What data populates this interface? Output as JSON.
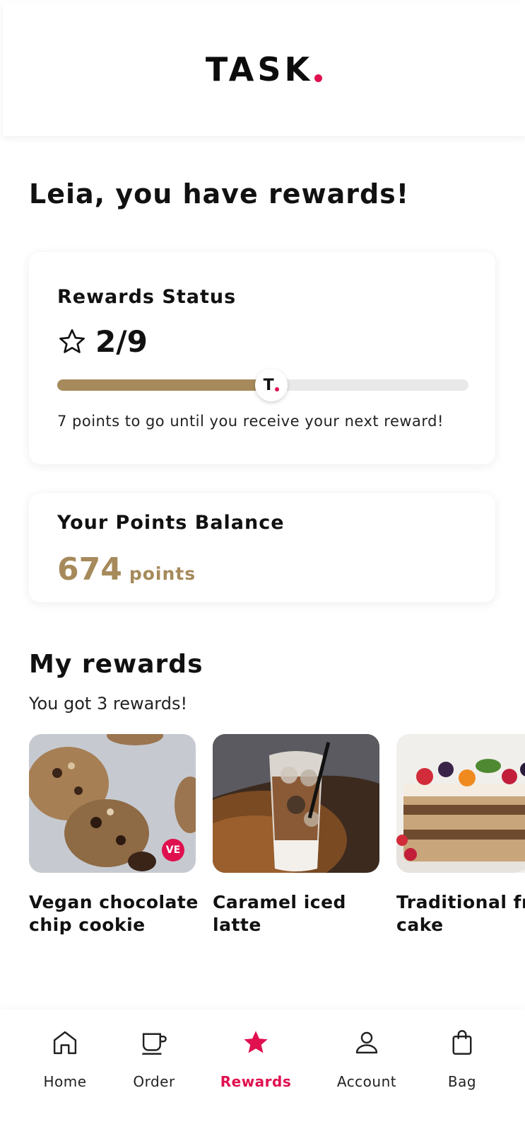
{
  "brand": {
    "name": "TASK",
    "accent": "#e0104f",
    "gold": "#a68a5b"
  },
  "greeting": "Leia, you have rewards!",
  "rewards_status": {
    "title": "Rewards Status",
    "count": "2/9",
    "progress_fraction": 0.52,
    "knob_letter": "T",
    "message": "7 points to go until you receive your next reward!"
  },
  "balance": {
    "title": "Your Points Balance",
    "value": "674",
    "unit": "points"
  },
  "my_rewards": {
    "title": "My rewards",
    "subtitle": "You got 3 rewards!",
    "items": [
      {
        "title": "Vegan chocolate chip cookie",
        "badge": "VE"
      },
      {
        "title": "Caramel iced latte"
      },
      {
        "title": "Traditional fruit cake"
      }
    ]
  },
  "nav": {
    "items": [
      {
        "label": "Home",
        "icon": "home-icon"
      },
      {
        "label": "Order",
        "icon": "cup-icon"
      },
      {
        "label": "Rewards",
        "icon": "star-icon",
        "active": true
      },
      {
        "label": "Account",
        "icon": "person-icon"
      },
      {
        "label": "Bag",
        "icon": "bag-icon"
      }
    ]
  }
}
